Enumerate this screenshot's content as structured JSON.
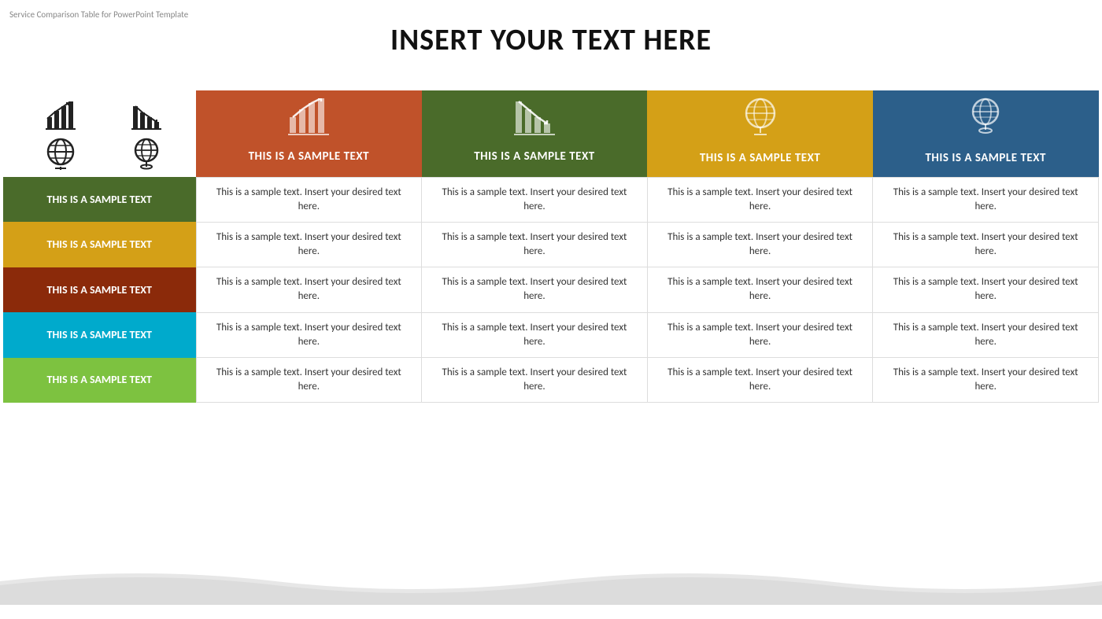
{
  "template_label": "Service Comparison Table for PowerPoint Template",
  "title": "INSERT YOUR TEXT HERE",
  "icons_top_left": [
    {
      "name": "bar-chart-up-icon",
      "symbol": "📊"
    },
    {
      "name": "bar-chart-down-icon",
      "symbol": "📉"
    },
    {
      "name": "globe-icon",
      "symbol": "🌐"
    },
    {
      "name": "globe2-icon",
      "symbol": "🌍"
    }
  ],
  "columns": [
    {
      "id": "col1",
      "header_text": "THIS IS A SAMPLE TEXT",
      "color": "#c0522a",
      "icon_type": "chart-up"
    },
    {
      "id": "col2",
      "header_text": "THIS IS A SAMPLE TEXT",
      "color": "#4a6b2a",
      "icon_type": "chart-down"
    },
    {
      "id": "col3",
      "header_text": "THIS IS A SAMPLE TEXT",
      "color": "#d4a017",
      "icon_type": "globe"
    },
    {
      "id": "col4",
      "header_text": "THIS IS A SAMPLE TEXT",
      "color": "#2c5f8a",
      "icon_type": "globe2"
    }
  ],
  "rows": [
    {
      "id": "row1",
      "header_text": "THIS IS A SAMPLE TEXT",
      "color": "#4a6b2a",
      "cells": [
        "This is a sample text. Insert your desired text here.",
        "This is a sample text. Insert your desired text here.",
        "This is a sample text. Insert your desired text here.",
        "This is a sample text. Insert your desired text here."
      ]
    },
    {
      "id": "row2",
      "header_text": "THIS IS A SAMPLE TEXT",
      "color": "#d4a017",
      "cells": [
        "This is a sample text. Insert your desired text here.",
        "This is a sample text. Insert your desired text here.",
        "This is a sample text. Insert your desired text here.",
        "This is a sample text. Insert your desired text here."
      ]
    },
    {
      "id": "row3",
      "header_text": "THIS IS A SAMPLE TEXT",
      "color": "#8b2a0a",
      "cells": [
        "This is a sample text. Insert your desired text here.",
        "This is a sample text. Insert your desired text here.",
        "This is a sample text. Insert your desired text here.",
        "This is a sample text. Insert your desired text here."
      ]
    },
    {
      "id": "row4",
      "header_text": "THIS IS A SAMPLE TEXT",
      "color": "#00aacc",
      "cells": [
        "This is a sample text. Insert your desired text here.",
        "This is a sample text. Insert your desired text here.",
        "This is a sample text. Insert your desired text here.",
        "This is a sample text. Insert your desired text here."
      ]
    },
    {
      "id": "row5",
      "header_text": "THIS IS A SAMPLE TEXT",
      "color": "#7dc240",
      "cells": [
        "This is a sample text. Insert your desired text here.",
        "This is a sample text. Insert your desired text here.",
        "This is a sample text. Insert your desired text here.",
        "This is a sample text. Insert your desired text here."
      ]
    }
  ]
}
